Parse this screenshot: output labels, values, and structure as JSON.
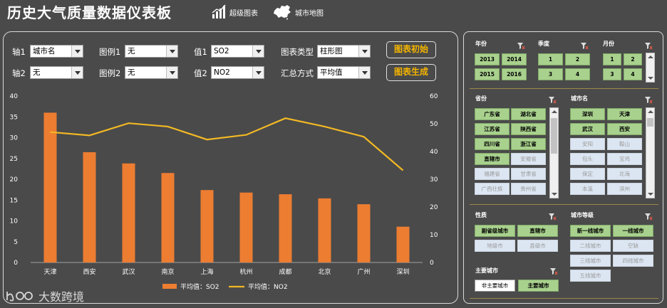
{
  "header": {
    "title": "历史大气质量数据仪表板",
    "link_chart": "超级图表",
    "link_map": "城市地图"
  },
  "controls": {
    "axis1_label": "轴1",
    "axis1_value": "城市名",
    "legend1_label": "图例1",
    "legend1_value": "无",
    "value1_label": "值1",
    "value1_value": "SO2",
    "charttype_label": "图表类型",
    "charttype_value": "柱形图",
    "axis2_label": "轴2",
    "axis2_value": "无",
    "legend2_label": "图例2",
    "legend2_value": "无",
    "value2_label": "值2",
    "value2_value": "NO2",
    "summary_label": "汇总方式",
    "summary_value": "平均值",
    "btn_init": "图表初始",
    "btn_generate": "图表生成"
  },
  "chart_data": {
    "type": "bar",
    "categories": [
      "天津",
      "西安",
      "武汉",
      "南京",
      "上海",
      "杭州",
      "成都",
      "北京",
      "广州",
      "深圳"
    ],
    "series": [
      {
        "name": "平均值：SO2",
        "type": "bar",
        "axis": "left",
        "color": "#ed7d31",
        "values": [
          36,
          26.5,
          23.8,
          21.5,
          17.4,
          16.8,
          16.4,
          15.4,
          14,
          8.6
        ]
      },
      {
        "name": "平均值：NO2",
        "type": "line",
        "axis": "right",
        "color": "#f2b824",
        "values": [
          47,
          45.8,
          50.2,
          49,
          44.3,
          46,
          52,
          49,
          45.3,
          33.2
        ]
      }
    ],
    "ylim_left": [
      0,
      40
    ],
    "yticks_left": [
      0,
      5,
      10,
      15,
      20,
      25,
      30,
      35,
      40
    ],
    "ylim_right": [
      0,
      60
    ],
    "yticks_right": [
      0,
      10,
      20,
      30,
      40,
      50,
      60
    ],
    "legend_position": "bottom"
  },
  "slicers": {
    "year": {
      "title": "年份",
      "items": [
        "2013",
        "2014",
        "2015",
        "2016"
      ]
    },
    "quarter": {
      "title": "季度",
      "items": [
        "1",
        "2",
        "3",
        "4"
      ]
    },
    "month": {
      "title": "月份",
      "items": [
        "1",
        "2",
        "3",
        "4"
      ]
    },
    "province": {
      "title": "省份",
      "items": [
        "广东省",
        "湖北省",
        "江苏省",
        "陕西省",
        "四川省",
        "浙江省",
        "直辖市",
        "安徽省",
        "福建省",
        "甘肃省",
        "广西壮族",
        "贵州省"
      ]
    },
    "city": {
      "title": "城市名",
      "items": [
        "深圳",
        "天津",
        "武汉",
        "西安",
        "安阳",
        "鞍山",
        "包头",
        "宝鸡",
        "保定",
        "北海",
        "本溪",
        "滨州"
      ]
    },
    "nature": {
      "title": "性质",
      "items": [
        "副省级城市",
        "直辖市",
        "地级市",
        "县级市"
      ]
    },
    "citylevel": {
      "title": "城市等级",
      "items": [
        "新一线城市",
        "一线城市",
        "二线城市",
        "空缺",
        "三线城市",
        "四线城市",
        "五线城市"
      ]
    },
    "major": {
      "title": "主要城市",
      "items": [
        "非主要城市",
        "主要城市"
      ]
    }
  },
  "watermark": "大数跨境"
}
